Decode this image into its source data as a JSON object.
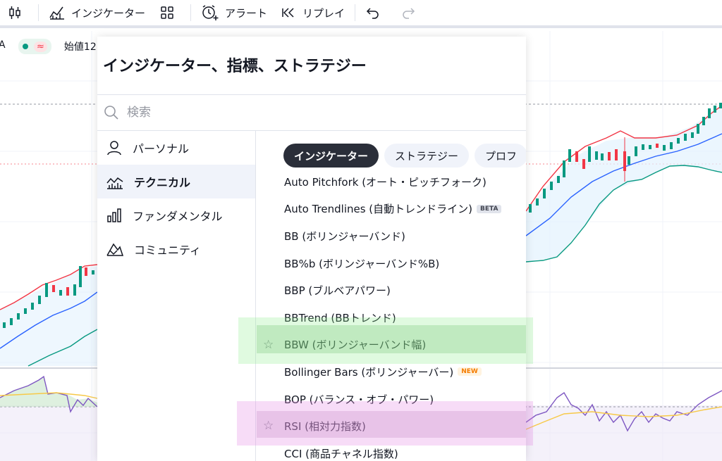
{
  "toolbar": {
    "indicators_label": "インジケーター",
    "alert_label": "アラート",
    "replay_label": "リプレイ"
  },
  "legend": {
    "prefix": "A",
    "wave_symbol": "≈",
    "open_label": "始値12"
  },
  "dialog": {
    "title": "インジケーター、指標、ストラテジー",
    "search_placeholder": "検索",
    "sidebar": [
      {
        "label": "パーソナル",
        "icon": "user-icon"
      },
      {
        "label": "テクニカル",
        "icon": "chart-wave-icon",
        "active": true
      },
      {
        "label": "ファンダメンタル",
        "icon": "bar-chart-icon"
      },
      {
        "label": "コミュニティ",
        "icon": "community-icon"
      }
    ],
    "tabs": [
      {
        "label": "インジケーター",
        "active": true
      },
      {
        "label": "ストラテジー"
      },
      {
        "label": "プロフ"
      }
    ],
    "items": [
      {
        "label": "Auto Pitchfork (オート・ピッチフォーク)"
      },
      {
        "label": "Auto Trendlines (自動トレンドライン)",
        "badge": "BETA"
      },
      {
        "label": "BB (ボリンジャーバンド)"
      },
      {
        "label": "BB%b (ボリンジャーバンド%B)"
      },
      {
        "label": "BBP (ブルベアパワー)"
      },
      {
        "label": "BBTrend (BBトレンド)"
      },
      {
        "label": "BBW (ボリンジャーバンド幅)",
        "star": true
      },
      {
        "label": "Bollinger Bars (ボリンジャーバー)",
        "badge": "NEW"
      },
      {
        "label": "BOP (バランス・オブ・パワー)"
      },
      {
        "label": "RSI (相対力指数)",
        "star": true
      },
      {
        "label": "CCI (商品チャネル指数)"
      }
    ]
  },
  "colors": {
    "up": "#089981",
    "down": "#f23645",
    "basis": "#2962ff",
    "upper": "#f23645",
    "lower": "#089981",
    "rsi": "#7e57c2",
    "rsi_ma": "#f7c948"
  }
}
